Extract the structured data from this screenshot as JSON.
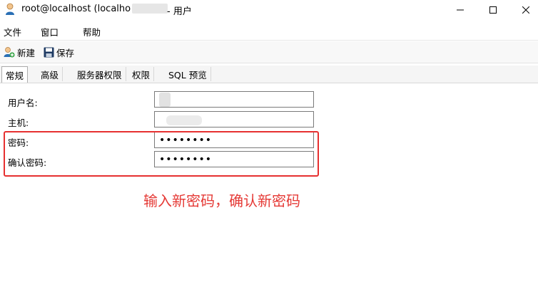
{
  "window": {
    "title": "root@localhost (localho",
    "title_suffix": "- 用户",
    "controls": [
      "minimize",
      "maximize",
      "close"
    ]
  },
  "menu": {
    "items": [
      "文件",
      "窗口",
      "帮助"
    ]
  },
  "toolbar": {
    "new_label": "新建",
    "save_label": "保存"
  },
  "tabs": [
    {
      "label": "常规",
      "active": true
    },
    {
      "label": "高级",
      "active": false
    },
    {
      "label": "服务器权限",
      "active": false
    },
    {
      "label": "权限",
      "active": false
    },
    {
      "label": "SQL 预览",
      "active": false
    }
  ],
  "form": {
    "username_label": "用户名:",
    "host_label": "主机:",
    "password_label": "密码:",
    "confirm_label": "确认密码:",
    "password_value": "••••••••",
    "confirm_value": "••••••••"
  },
  "annotation": {
    "text": "输入新密码，确认新密码",
    "color": "#e53935"
  },
  "colors": {
    "highlight_border": "#e63030"
  }
}
